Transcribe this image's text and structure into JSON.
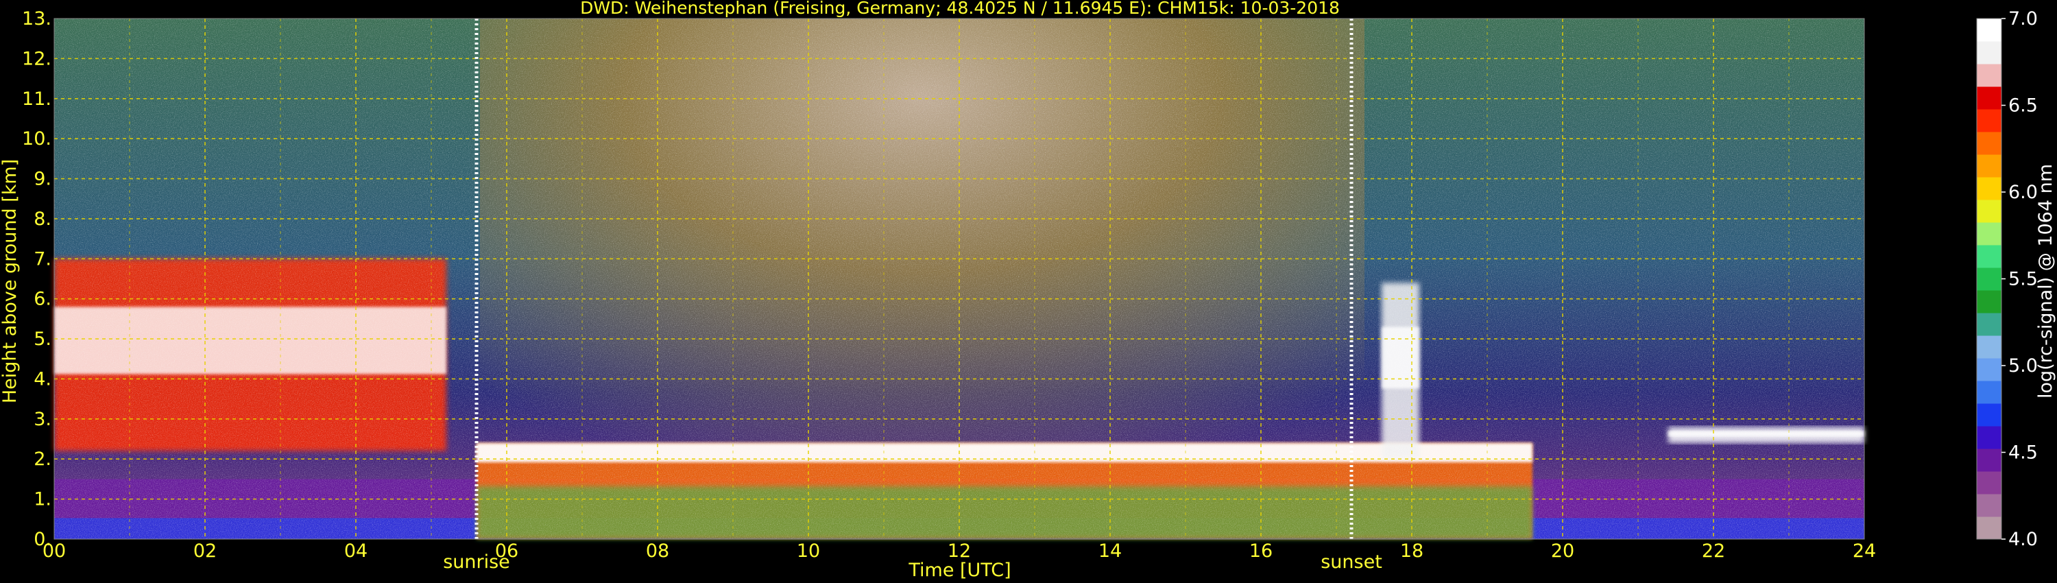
{
  "chart_data": {
    "type": "heatmap",
    "title": "DWD: Weihenstephan (Freising, Germany; 48.4025 N / 11.6945 E):    CHM15k: 10-03-2018",
    "xlabel": "Time [UTC]",
    "ylabel": "Height above ground [km]",
    "xlim": [
      0,
      24
    ],
    "ylim": [
      0,
      13
    ],
    "x_ticks": [
      "00",
      "02",
      "04",
      "06",
      "08",
      "10",
      "12",
      "14",
      "16",
      "18",
      "20",
      "22",
      "24"
    ],
    "y_ticks": [
      "0.",
      "1.",
      "2.",
      "3.",
      "4.",
      "5.",
      "6.",
      "7.",
      "8.",
      "9.",
      "10.",
      "11.",
      "12.",
      "13."
    ],
    "grid": true,
    "markers": [
      {
        "label": "sunrise",
        "time": 5.6
      },
      {
        "label": "sunset",
        "time": 17.2
      }
    ],
    "colorbar": {
      "label": "log(rc-signal) @ 1064 nm",
      "range": [
        4.0,
        7.0
      ],
      "ticks": [
        "4.0",
        "4.5",
        "5.0",
        "5.5",
        "6.0",
        "6.5",
        "7.0"
      ]
    },
    "features": [
      {
        "name": "boundary layer base",
        "from": 0,
        "to": 24,
        "height": [
          0,
          1.5
        ]
      },
      {
        "name": "elevated layer night",
        "from": 0,
        "to": 5.2,
        "height": [
          2.2,
          7.0
        ]
      },
      {
        "name": "boundary layer top",
        "from": 5.6,
        "to": 19.6,
        "height": [
          1.6,
          2.4
        ]
      },
      {
        "name": "convective plume",
        "from": 17.6,
        "to": 18.1,
        "height": [
          2.0,
          6.4
        ]
      },
      {
        "name": "evening layer",
        "from": 21.4,
        "to": 24,
        "height": [
          2.4,
          2.8
        ]
      }
    ]
  },
  "colors": {
    "text": "#ffff33",
    "grid": "#e6d200",
    "background": "#000000",
    "colormap": [
      "#b79aa6",
      "#a46e9f",
      "#8b3d97",
      "#6a1aa0",
      "#3a10c8",
      "#1a3cf0",
      "#3a78ee",
      "#6aa0f0",
      "#8ab8e8",
      "#3aa890",
      "#1fa02a",
      "#22c050",
      "#40e080",
      "#a0f070",
      "#e8f020",
      "#ffd000",
      "#ffa000",
      "#ff6a00",
      "#ff2a00",
      "#e00000",
      "#f0b8b8",
      "#f2f2f2",
      "#ffffff"
    ]
  }
}
